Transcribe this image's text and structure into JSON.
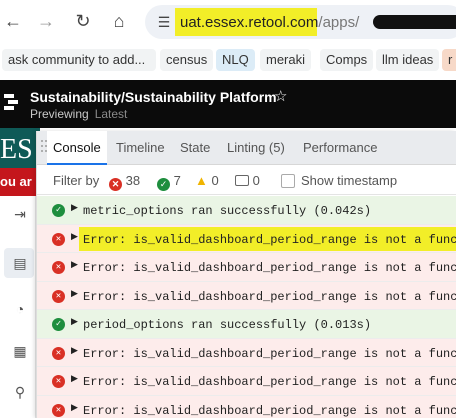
{
  "browser": {
    "url_host": "uat.essex.retool.com",
    "url_path": "/apps/",
    "bookmarks": [
      "ask community to add...",
      "census",
      "NLQ",
      "meraki",
      "Comps",
      "llm ideas",
      "r"
    ]
  },
  "app": {
    "title": "Sustainability/Sustainability Platform",
    "mode": "Previewing",
    "version": "Latest",
    "background_text_1": "ES",
    "background_text_2": "ou ar"
  },
  "debug_panel": {
    "tabs": [
      "Console",
      "Timeline",
      "State",
      "Linting (5)",
      "Performance"
    ],
    "active_tab": "Console",
    "filter_label": "Filter by",
    "counts": {
      "errors": "38",
      "success": "7",
      "warnings": "0",
      "info": "0"
    },
    "timestamp_label": "Show timestamp",
    "rows": [
      {
        "type": "ok",
        "text": "metric_options ran successfully (0.042s)",
        "highlighted": false
      },
      {
        "type": "err",
        "text": "Error: is_valid_dashboard_period_range is not a function",
        "highlighted": true
      },
      {
        "type": "err",
        "text": "Error: is_valid_dashboard_period_range is not a function",
        "highlighted": false
      },
      {
        "type": "err",
        "text": "Error: is_valid_dashboard_period_range is not a function",
        "highlighted": false
      },
      {
        "type": "ok",
        "text": "period_options ran successfully (0.013s)",
        "highlighted": false
      },
      {
        "type": "err",
        "text": "Error: is_valid_dashboard_period_range is not a function",
        "highlighted": false
      },
      {
        "type": "err",
        "text": "Error: is_valid_dashboard_period_range is not a function",
        "highlighted": false
      },
      {
        "type": "err",
        "text": "Error: is_valid_dashboard_period_range is not a function",
        "highlighted": false
      }
    ]
  },
  "colors": {
    "highlight": "#f2ee28",
    "error": "#d93025",
    "success": "#1e8e3e",
    "header": "#0b0b0b"
  }
}
